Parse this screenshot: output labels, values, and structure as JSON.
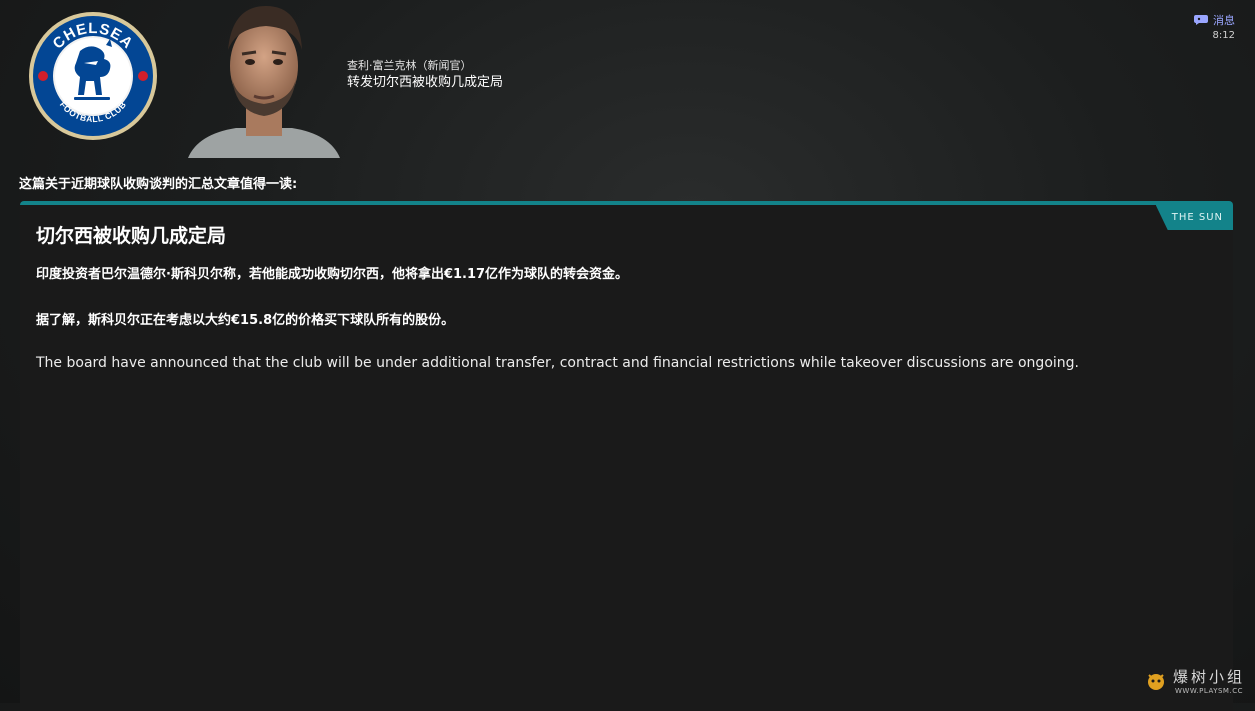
{
  "crest": {
    "top_text": "CHELSEA",
    "bottom_text": "FOOTBALL CLUB",
    "color": "#034694"
  },
  "sender": {
    "name": "查利·富兰克林（新闻官）",
    "subject": "转发切尔西被收购几成定局"
  },
  "topbar": {
    "messages_label": "消息",
    "time": "8:12"
  },
  "intro_text": "这篇关于近期球队收购谈判的汇总文章值得一读:",
  "article": {
    "source": "THE SUN",
    "headline": "切尔西被收购几成定局",
    "paragraphs": [
      "印度投资者巴尔温德尔·斯科贝尔称，若他能成功收购切尔西，他将拿出€1.17亿作为球队的转会资金。",
      "据了解，斯科贝尔正在考虑以大约€15.8亿的价格买下球队所有的股份。",
      "The board have announced that the club will be under additional transfer, contract and financial restrictions while takeover discussions are ongoing."
    ]
  },
  "watermark": {
    "cn": "爆树小组",
    "url": "WWW.PLAYSM.CC"
  },
  "colors": {
    "accent": "#13838a",
    "link": "#9aa6ff",
    "background": "#1a1a1a"
  },
  "icons": {
    "messages": "speech-bubble-icon"
  }
}
